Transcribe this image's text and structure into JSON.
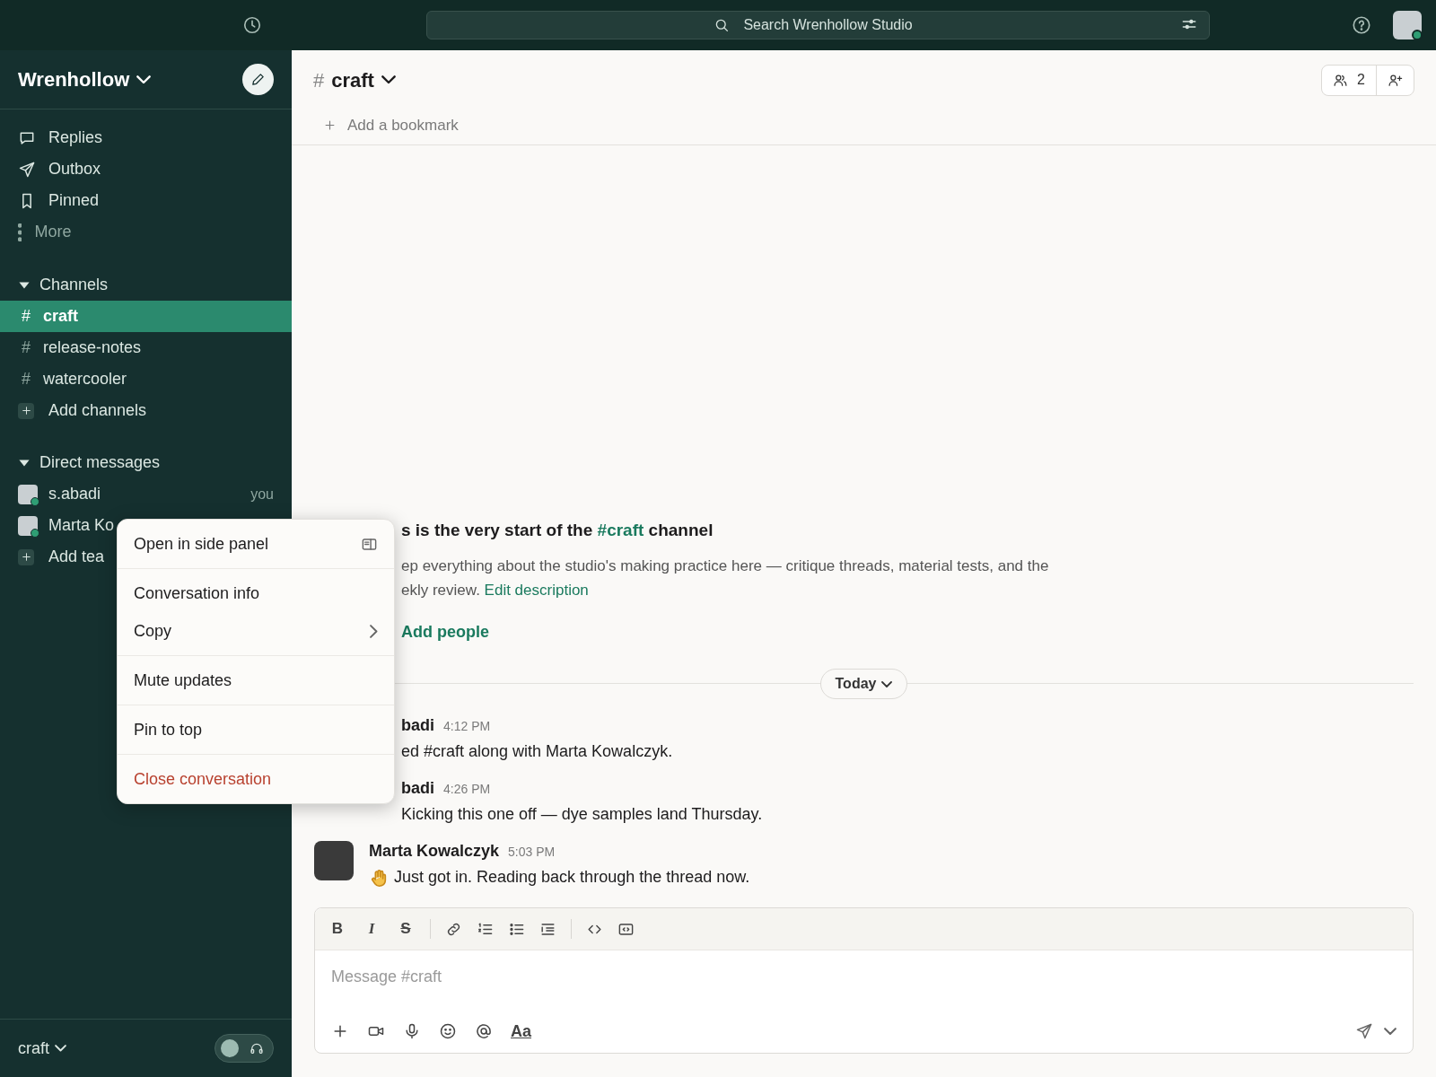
{
  "topbar": {
    "search": {
      "placeholder": "Search Wrenhollow Studio"
    }
  },
  "sidebar": {
    "workspace": "Wrenhollow",
    "nav": [
      {
        "label": "Replies",
        "kind": "replies"
      },
      {
        "label": "Outbox",
        "kind": "outbox"
      },
      {
        "label": "Pinned",
        "kind": "pinned"
      },
      {
        "label": "More",
        "kind": "more"
      }
    ],
    "channels_header": "Channels",
    "channels": [
      {
        "hash": "#",
        "name": "craft",
        "selected": true
      },
      {
        "hash": "#",
        "name": "release-notes",
        "selected": false
      },
      {
        "hash": "#",
        "name": "watercooler",
        "selected": false
      }
    ],
    "add_channels": "Add channels",
    "dm_header": "Direct messages",
    "dms": [
      {
        "name": "s.abadi",
        "note": "you"
      },
      {
        "name": "Marta Ko"
      }
    ],
    "add_teammates": "Add tea",
    "footer": {
      "label": "craft",
      "huddle_on": false
    }
  },
  "context_menu": {
    "groups": [
      [
        {
          "label": "Open in side panel",
          "kind": "panel"
        }
      ],
      [
        {
          "label": "Conversation info",
          "kind": "plain"
        },
        {
          "label": "Copy",
          "kind": "submenu"
        }
      ],
      [
        {
          "label": "Mute updates",
          "kind": "plain"
        }
      ],
      [
        {
          "label": "Pin to top",
          "kind": "plain"
        }
      ],
      [
        {
          "label": "Close conversation",
          "kind": "danger"
        }
      ]
    ]
  },
  "channel": {
    "hash": "#",
    "name": "craft",
    "member_count": "2",
    "bookmark": "Add a bookmark"
  },
  "intro": {
    "title_before": "s is the very start of the",
    "title_channel": "#craft",
    "title_after": "channel",
    "description_lines": [
      "ep everything about the studio's making practice here — critique threads, material tests, and the",
      "ekly review."
    ],
    "edit_link": "Edit description",
    "add_people": "Add people"
  },
  "day_divider": "Today",
  "messages": [
    {
      "kind": "partial",
      "author": "badi",
      "time": "4:12 PM",
      "text": "ed #craft along with Marta Kowalczyk."
    },
    {
      "kind": "partial",
      "author": "badi",
      "time": "4:26 PM",
      "text": "Kicking this one off — dye samples land Thursday."
    },
    {
      "kind": "full",
      "author": "Marta Kowalczyk",
      "time": "5:03 PM",
      "text": "Just got in. Reading back through the thread now.",
      "wave": true
    }
  ],
  "composer": {
    "format_letters": [
      {
        "label": "B",
        "kind": "bold"
      },
      {
        "label": "I",
        "kind": "italic"
      },
      {
        "label": "S",
        "kind": "strike"
      }
    ],
    "placeholder": "Message #craft",
    "text_style": "Aa"
  }
}
